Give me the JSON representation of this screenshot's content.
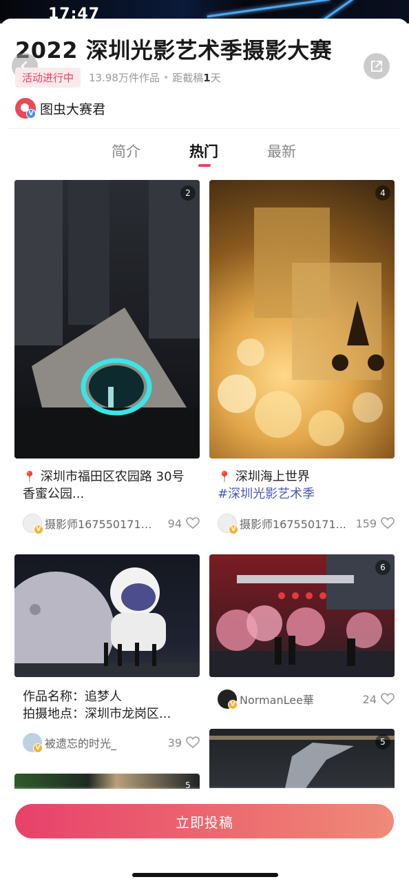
{
  "status_bar": {
    "time": "17:47"
  },
  "header": {
    "title": "2022 深圳光影艺术季摄影大赛",
    "status_badge": "活动进行中",
    "works_count": "13.98万件作品",
    "deadline_prefix": "距截稿",
    "deadline_days": "1",
    "deadline_suffix": "天",
    "back_icon": "chevron-left-icon",
    "share_icon": "share-icon"
  },
  "organizer": {
    "name": "图虫大赛君",
    "verified_badge": "V"
  },
  "tabs": [
    {
      "label": "简介",
      "active": false
    },
    {
      "label": "热门",
      "active": true
    },
    {
      "label": "最新",
      "active": false
    }
  ],
  "cards": [
    {
      "image_count": "2",
      "pin": "📍",
      "text": "深圳市福田区农园路 30号 香蜜公园...",
      "user": "摄影师1675501719...",
      "likes": "94",
      "badge": "V"
    },
    {
      "image_count": "4",
      "pin": "📍",
      "text": "深圳海上世界",
      "hashtag": "#深圳光影艺术季",
      "user": "摄影师167550171...",
      "likes": "159",
      "badge": "V"
    },
    {
      "line1": "作品名称：追梦人",
      "line2": "拍摄地点：深圳市龙岗区...",
      "user": "被遗忘的时光_",
      "likes": "39",
      "badge": "V"
    },
    {
      "image_count": "6",
      "user": "NormanLee華",
      "likes": "24",
      "badge": "V"
    },
    {
      "image_count": "5"
    },
    {
      "image_count": "5"
    }
  ],
  "submit_button": {
    "label": "立即投稿"
  },
  "colors": {
    "accent": "#e8415f",
    "hashtag": "#4b58b6",
    "button_start": "#e8416b",
    "button_end": "#ef8a78"
  }
}
